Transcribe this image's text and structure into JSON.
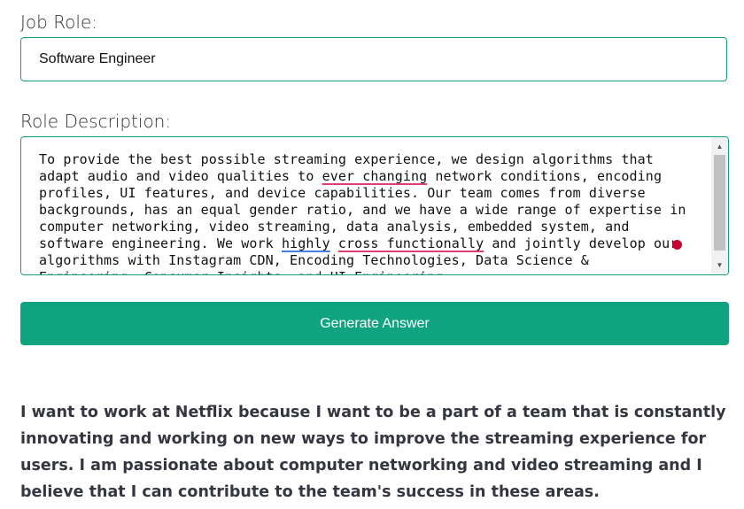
{
  "form": {
    "job_role_label": "Job Role:",
    "job_role_value": "Software Engineer",
    "role_description_label": "Role Description:",
    "role_description_parts": {
      "p1": "To provide the best possible streaming experience, we design algorithms that\nadapt audio and video qualities to ",
      "s1": "ever changing",
      "p2": " network conditions, encoding\nprofiles, UI features, and device capabilities. Our team comes from diverse\nbackgrounds, has an equal gender ratio, and we have a wide range of expertise in\ncomputer networking, video streaming, data analysis, embedded system, and\nsoftware engineering. We work ",
      "s2": "highly",
      "p3": " ",
      "s3": "cross functionally",
      "p4": " and jointly develop our\nalgorithms with Instagram CDN, Encoding Technologies, Data Science &\nEngineering, Consumer Insights, and UI Engineering."
    },
    "generate_button_label": "Generate Answer"
  },
  "answer": {
    "text": "I want to work at Netflix because I want to be a part of a team that is constantly innovating and working on new ways to improve the streaming experience for users. I am passionate about computer networking and video streaming and I believe that I can contribute to the team's success in these areas."
  },
  "colors": {
    "accent": "#10a37f",
    "spell_error": "#e04070",
    "grammar_hint": "#4a7ee0",
    "cursor_dot": "#cc0033"
  },
  "icons": {
    "scroll_up": "triangle-up",
    "scroll_down": "triangle-down"
  }
}
